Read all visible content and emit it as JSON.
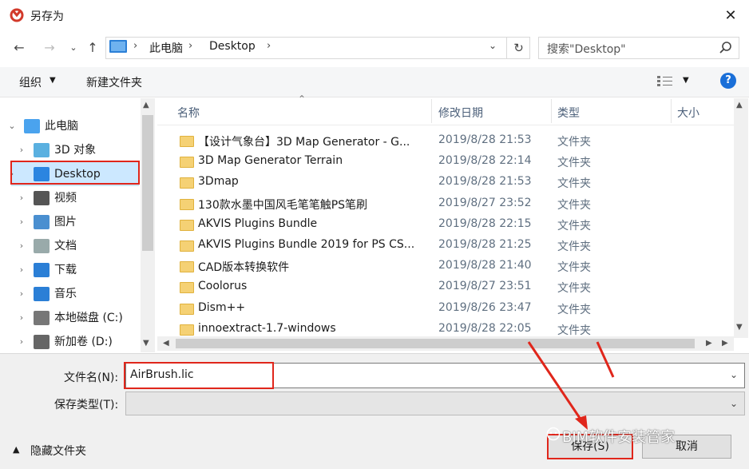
{
  "title": "另存为",
  "nav": {
    "back_icon": "back-arrow-icon",
    "forward_icon": "forward-arrow-icon",
    "recent_icon": "chevron-down-icon",
    "up_icon": "up-arrow-icon"
  },
  "address": {
    "crumbs": [
      "此电脑",
      "Desktop"
    ]
  },
  "search": {
    "placeholder": "搜索\"Desktop\""
  },
  "toolbar": {
    "organize": "组织",
    "new_folder": "新建文件夹"
  },
  "sidebar": {
    "items": [
      {
        "label": "此电脑",
        "icon": "pc-icon"
      },
      {
        "label": "3D 对象",
        "icon": "3d-objects-icon"
      },
      {
        "label": "Desktop",
        "icon": "desktop-icon"
      },
      {
        "label": "视频",
        "icon": "video-icon"
      },
      {
        "label": "图片",
        "icon": "pictures-icon"
      },
      {
        "label": "文档",
        "icon": "documents-icon"
      },
      {
        "label": "下载",
        "icon": "downloads-icon"
      },
      {
        "label": "音乐",
        "icon": "music-icon"
      },
      {
        "label": "本地磁盘 (C:)",
        "icon": "local-disk-icon"
      },
      {
        "label": "新加卷 (D:)",
        "icon": "drive-icon"
      }
    ]
  },
  "columns": {
    "name": "名称",
    "date": "修改日期",
    "type": "类型",
    "size": "大小"
  },
  "files": [
    {
      "name": "【设计气象台】3D Map Generator - G...",
      "date": "2019/8/28 21:53",
      "type": "文件夹"
    },
    {
      "name": "3D Map Generator Terrain",
      "date": "2019/8/28 22:14",
      "type": "文件夹"
    },
    {
      "name": "3Dmap",
      "date": "2019/8/28 21:53",
      "type": "文件夹"
    },
    {
      "name": "130款水墨中国风毛笔笔触PS笔刷",
      "date": "2019/8/27 23:52",
      "type": "文件夹"
    },
    {
      "name": "AKVIS Plugins Bundle",
      "date": "2019/8/28 22:15",
      "type": "文件夹"
    },
    {
      "name": "AKVIS Plugins Bundle 2019 for PS CS...",
      "date": "2019/8/28 21:25",
      "type": "文件夹"
    },
    {
      "name": "CAD版本转换软件",
      "date": "2019/8/28 21:40",
      "type": "文件夹"
    },
    {
      "name": "Coolorus",
      "date": "2019/8/27 23:51",
      "type": "文件夹"
    },
    {
      "name": "Dism++",
      "date": "2019/8/26 23:47",
      "type": "文件夹"
    },
    {
      "name": "innoextract-1.7-windows",
      "date": "2019/8/28 22:05",
      "type": "文件夹"
    }
  ],
  "form": {
    "filename_label": "文件名(N):",
    "filename_value": "AirBrush.lic",
    "type_label": "保存类型(T):",
    "type_value": ""
  },
  "footer": {
    "hide_folders": "隐藏文件夹",
    "save": "保存(S)",
    "cancel": "取消"
  },
  "watermark": "BIM软件安装管家",
  "colors": {
    "highlight_box": "#e0261b",
    "help": "#1a6fd8",
    "folder": "#f5d174"
  }
}
